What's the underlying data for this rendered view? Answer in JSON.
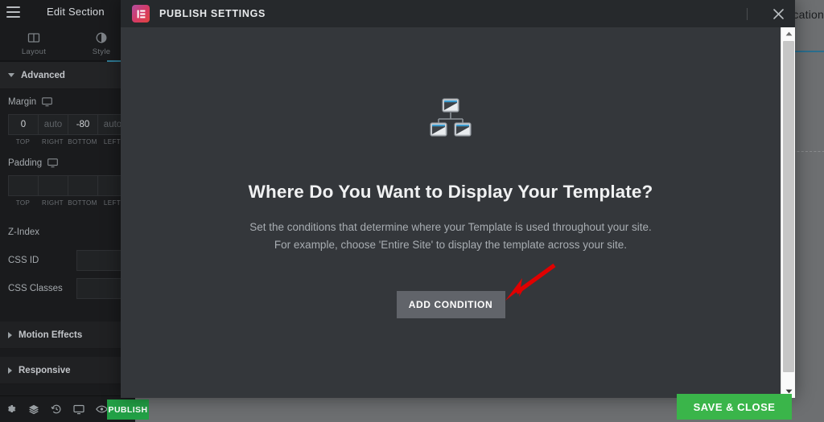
{
  "canvas": {
    "partial_text": "lication",
    "accent_line_color": "#2a6e8e"
  },
  "editor_panel": {
    "title": "Edit Section",
    "menu_icon": "hamburger-icon",
    "tabs": [
      {
        "label": "Layout",
        "icon": "layout-columns-icon",
        "active": false
      },
      {
        "label": "Style",
        "icon": "contrast-circle-icon",
        "active": false
      }
    ],
    "sections": [
      {
        "label": "Advanced",
        "expanded": true
      },
      {
        "label": "Motion Effects",
        "expanded": false
      },
      {
        "label": "Responsive",
        "expanded": false
      }
    ],
    "margin": {
      "label": "Margin",
      "device_icon": "desktop-monitor-icon",
      "fields": [
        {
          "value": "0",
          "sub": "TOP",
          "placeholder": false
        },
        {
          "value": "auto",
          "sub": "RIGHT",
          "placeholder": true
        },
        {
          "value": "-80",
          "sub": "BOTTOM",
          "placeholder": false
        },
        {
          "value": "auto",
          "sub": "LEFT",
          "placeholder": true
        }
      ]
    },
    "padding": {
      "label": "Padding",
      "device_icon": "desktop-monitor-icon",
      "fields": [
        {
          "value": "",
          "sub": "TOP",
          "placeholder": true
        },
        {
          "value": "",
          "sub": "RIGHT",
          "placeholder": true
        },
        {
          "value": "",
          "sub": "BOTTOM",
          "placeholder": true
        },
        {
          "value": "",
          "sub": "LEFT",
          "placeholder": true
        }
      ]
    },
    "fields": [
      {
        "label": "Z-Index",
        "value": "",
        "has_input": false
      },
      {
        "label": "CSS ID",
        "value": "",
        "has_input": true
      },
      {
        "label": "CSS Classes",
        "value": "",
        "has_input": true
      }
    ],
    "footer": {
      "icons": [
        "settings-gear-icon",
        "layers-navigator-icon",
        "history-clock-icon",
        "responsive-monitor-icon",
        "preview-eye-icon"
      ],
      "publish_label": "PUBLISH"
    }
  },
  "modal": {
    "logo_icon": "elementor-logo-icon",
    "title": "PUBLISH SETTINGS",
    "close_icon": "close-x-icon",
    "hero_icon": "sitemap-hierarchy-icon",
    "heading": "Where Do You Want to Display Your Template?",
    "description_line1": "Set the conditions that determine where your Template is used throughout your site.",
    "description_line2": "For example, choose 'Entire Site' to display the template across your site.",
    "add_condition_label": "ADD CONDITION",
    "scrollbar": {
      "up_icon": "scroll-up-arrow-icon",
      "down_icon": "scroll-down-arrow-icon"
    }
  },
  "footer_bar": {
    "save_close_label": "SAVE & CLOSE",
    "save_color": "#3ab54a"
  },
  "annotation": {
    "arrow_color": "#e00000",
    "arrow_name": "red-pointer-arrow"
  }
}
